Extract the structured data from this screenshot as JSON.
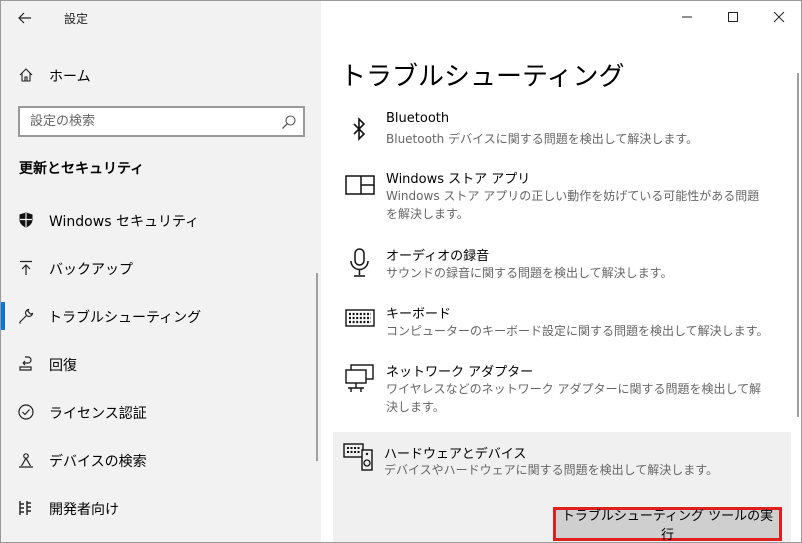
{
  "window": {
    "title": "設定"
  },
  "left": {
    "home_label": "ホーム",
    "search_placeholder": "設定の検索",
    "section_title": "更新とセキュリティ",
    "nav_items": [
      {
        "label": "Windows セキュリティ",
        "icon": "shield-icon"
      },
      {
        "label": "バックアップ",
        "icon": "backup-icon"
      },
      {
        "label": "トラブルシューティング",
        "icon": "wrench-icon",
        "selected": true
      },
      {
        "label": "回復",
        "icon": "recovery-icon"
      },
      {
        "label": "ライセンス認証",
        "icon": "check-circle-icon"
      },
      {
        "label": "デバイスの検索",
        "icon": "find-device-icon"
      },
      {
        "label": "開発者向け",
        "icon": "developer-icon"
      }
    ]
  },
  "main": {
    "page_title": "トラブルシューティング",
    "items": [
      {
        "title": "Bluetooth",
        "desc": "Bluetooth デバイスに関する問題を検出して解決します。",
        "icon": "bluetooth-icon"
      },
      {
        "title": "Windows ストア アプリ",
        "desc": "Windows ストア アプリの正しい動作を妨げている可能性がある問題を解決します。",
        "icon": "store-app-icon"
      },
      {
        "title": "オーディオの録音",
        "desc": "サウンドの録音に関する問題を検出して解決します。",
        "icon": "microphone-icon"
      },
      {
        "title": "キーボード",
        "desc": "コンピューターのキーボード設定に関する問題を検出して解決します。",
        "icon": "keyboard-icon"
      },
      {
        "title": "ネットワーク アダプター",
        "desc": "ワイヤレスなどのネットワーク アダプターに関する問題を検出して解決します。",
        "icon": "network-adapter-icon"
      },
      {
        "title": "ハードウェアとデバイス",
        "desc": "デバイスやハードウェアに関する問題を検出して解決します。",
        "icon": "hardware-icon",
        "expanded": true
      }
    ],
    "run_button": "トラブルシューティング ツールの実行"
  },
  "colors": {
    "accent": "#0078d7",
    "highlight_border": "#e0201d"
  }
}
